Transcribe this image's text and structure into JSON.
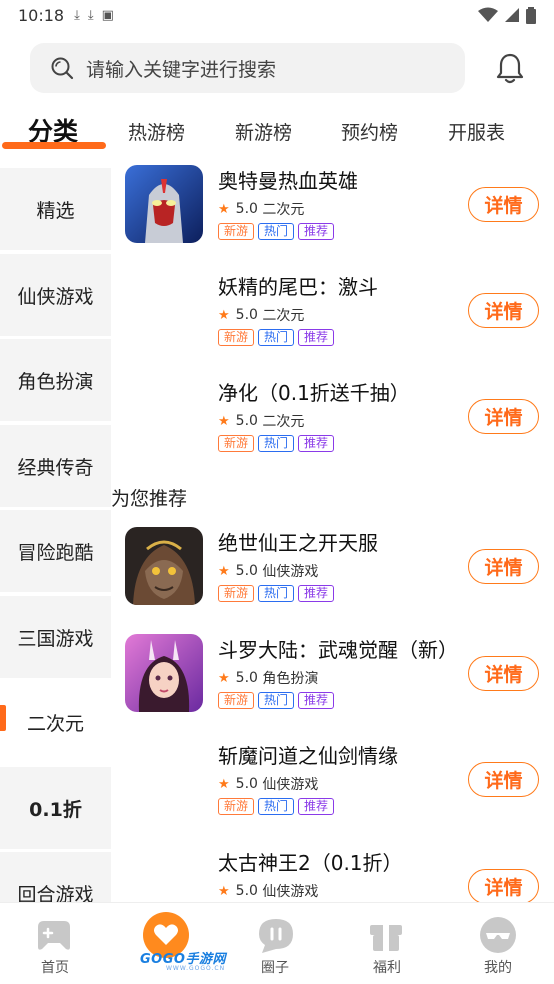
{
  "status_bar": {
    "time": "10:18"
  },
  "search": {
    "placeholder": "请输入关键字进行搜索"
  },
  "tabs": [
    {
      "label": "分类"
    },
    {
      "label": "热游榜"
    },
    {
      "label": "新游榜"
    },
    {
      "label": "预约榜"
    },
    {
      "label": "开服表"
    }
  ],
  "categories": [
    {
      "label": "精选"
    },
    {
      "label": "仙侠游戏"
    },
    {
      "label": "角色扮演"
    },
    {
      "label": "经典传奇"
    },
    {
      "label": "冒险跑酷"
    },
    {
      "label": "三国游戏"
    },
    {
      "label": "二次元"
    },
    {
      "label": "0.1折"
    },
    {
      "label": "回合游戏"
    }
  ],
  "tag_labels": {
    "new": "新游",
    "hot": "热门",
    "rec": "推荐"
  },
  "detail_label": "详情",
  "games": [
    {
      "name": "奥特曼热血英雄",
      "rating": "5.0",
      "genre": "二次元"
    },
    {
      "name": "妖精的尾巴：激斗",
      "rating": "5.0",
      "genre": "二次元"
    },
    {
      "name": "净化（0.1折送千抽）",
      "rating": "5.0",
      "genre": "二次元"
    }
  ],
  "recommend_title": "为您推荐",
  "recommended": [
    {
      "name": "绝世仙王之开天服",
      "rating": "5.0",
      "genre": "仙侠游戏"
    },
    {
      "name": "斗罗大陆：武魂觉醒（新）",
      "rating": "5.0",
      "genre": "角色扮演"
    },
    {
      "name": "斩魔问道之仙剑情缘",
      "rating": "5.0",
      "genre": "仙侠游戏"
    },
    {
      "name": "太古神王2（0.1折）",
      "rating": "5.0",
      "genre": "仙侠游戏"
    }
  ],
  "bottom_nav": [
    {
      "label": "首页"
    },
    {
      "label": ""
    },
    {
      "label": "圈子"
    },
    {
      "label": "福利"
    },
    {
      "label": "我的"
    }
  ],
  "watermark": {
    "text": "GOGO手游网",
    "sub": "WWW.GOGO.CN"
  },
  "colors": {
    "accent": "#ff6a1a",
    "tag_new": "#ff7a3a",
    "tag_hot": "#2b6cf0",
    "tag_rec": "#8a3ae8"
  }
}
